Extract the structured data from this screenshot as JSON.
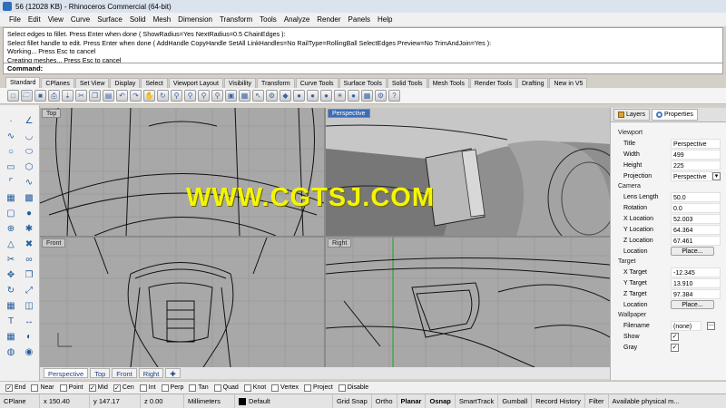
{
  "window": {
    "title": "56 (12028 KB) - Rhinoceros Commercial (64-bit)"
  },
  "menu": [
    "File",
    "Edit",
    "View",
    "Curve",
    "Surface",
    "Solid",
    "Mesh",
    "Dimension",
    "Transform",
    "Tools",
    "Analyze",
    "Render",
    "Panels",
    "Help"
  ],
  "history": [
    "Select edges to fillet. Press Enter when done ( ShowRadius=Yes  NextRadius=0.5  ChainEdges ):",
    "Select fillet handle to edit. Press Enter when done ( AddHandle  CopyHandle  SetAll  LinkHandles=No  RailType=RollingBall  SelectEdges  Preview=No  TrimAndJoin=Yes ):",
    "Working... Press Esc to cancel",
    "Creating meshes... Press Esc to cancel"
  ],
  "command": {
    "label": "Command:"
  },
  "toolbar_tabs": [
    "Standard",
    "CPlanes",
    "Set View",
    "Display",
    "Select",
    "Viewport Layout",
    "Visibility",
    "Transform",
    "Curve Tools",
    "Surface Tools",
    "Solid Tools",
    "Mesh Tools",
    "Render Tools",
    "Drafting",
    "New in V5"
  ],
  "toolbar_icons": [
    "new-icon",
    "open-icon",
    "save-icon",
    "print-icon",
    "import-icon",
    "cut-icon",
    "copy-icon",
    "paste-icon",
    "undo-icon",
    "redo-icon",
    "pan-icon",
    "rotate-icon",
    "zoom-dynamic-icon",
    "zoom-window-icon",
    "zoom-extents-icon",
    "zoom-selected-icon",
    "view-icon",
    "layer-icon",
    "select-icon",
    "properties-icon",
    "car-icon",
    "shaded-icon",
    "rendered-icon",
    "render-icon",
    "light-icon",
    "material-icon",
    "grid-icon",
    "options-icon",
    "help-icon"
  ],
  "left_tools": [
    "point-icon",
    "polyline-icon",
    "curve-icon",
    "arc-icon",
    "circle-icon",
    "ellipse-icon",
    "rectangle-icon",
    "polygon-icon",
    "fillet-icon",
    "offset-icon",
    "surface-icon",
    "extrude-icon",
    "box-icon",
    "sphere-icon",
    "boolean-icon",
    "explode-icon",
    "mesh-icon",
    "split-icon",
    "trim-icon",
    "join-icon",
    "move-icon",
    "copy-tool-icon",
    "rotate-tool-icon",
    "scale-icon",
    "array-icon",
    "mirror-icon",
    "text-icon",
    "dimension-icon",
    "group-icon",
    "hide-icon",
    "analyze-icon",
    "render-tool-icon"
  ],
  "viewports": {
    "top": {
      "label": "Top"
    },
    "perspective": {
      "label": "Perspective"
    },
    "front": {
      "label": "Front"
    },
    "right": {
      "label": "Right"
    }
  },
  "viewport_tabs": [
    "Perspective",
    "Top",
    "Front",
    "Right"
  ],
  "watermark": "WWW.CGTSJ.COM",
  "panel": {
    "tabs": {
      "layers": "Layers",
      "properties": "Properties"
    },
    "viewport": {
      "section": "Viewport",
      "rows": [
        {
          "label": "Title",
          "value": "Perspective"
        },
        {
          "label": "Width",
          "value": "499"
        },
        {
          "label": "Height",
          "value": "225"
        },
        {
          "label": "Projection",
          "value": "Perspective"
        }
      ]
    },
    "camera": {
      "section": "Camera",
      "rows": [
        {
          "label": "Lens Length",
          "value": "50.0"
        },
        {
          "label": "Rotation",
          "value": "0.0"
        },
        {
          "label": "X Location",
          "value": "52.003"
        },
        {
          "label": "Y Location",
          "value": "64.364"
        },
        {
          "label": "Z Location",
          "value": "67.461"
        }
      ],
      "location_label": "Location",
      "place_button": "Place..."
    },
    "target": {
      "section": "Target",
      "rows": [
        {
          "label": "X Target",
          "value": "-12.345"
        },
        {
          "label": "Y Target",
          "value": "13.910"
        },
        {
          "label": "Z Target",
          "value": "97.384"
        }
      ],
      "location_label": "Location",
      "place_button": "Place..."
    },
    "wallpaper": {
      "section": "Wallpaper",
      "filename_label": "Filename",
      "filename_value": "(none)",
      "show_label": "Show",
      "gray_label": "Gray"
    }
  },
  "osnaps": [
    {
      "label": "End",
      "checked": true
    },
    {
      "label": "Near",
      "checked": false
    },
    {
      "label": "Point",
      "checked": false
    },
    {
      "label": "Mid",
      "checked": true
    },
    {
      "label": "Cen",
      "checked": true
    },
    {
      "label": "Int",
      "checked": false
    },
    {
      "label": "Perp",
      "checked": false
    },
    {
      "label": "Tan",
      "checked": false
    },
    {
      "label": "Quad",
      "checked": false
    },
    {
      "label": "Knot",
      "checked": false
    },
    {
      "label": "Vertex",
      "checked": false
    },
    {
      "label": "Project",
      "checked": false
    },
    {
      "label": "Disable",
      "checked": false
    }
  ],
  "status": {
    "cplane": "CPlane",
    "x": "x 150.40",
    "y": "y 147.17",
    "z": "z 0.00",
    "units": "Millimeters",
    "layer": "Default",
    "grid_snap": "Grid Snap",
    "ortho": "Ortho",
    "planar": "Planar",
    "osnap": "Osnap",
    "smarttrack": "SmartTrack",
    "gumball": "Gumball",
    "record_history": "Record History",
    "filter": "Filter",
    "memory": "Available physical m..."
  },
  "colors": {
    "active_viewport": "#3a6db5",
    "watermark": "#f5f500",
    "layer_swatch": "#000000"
  }
}
